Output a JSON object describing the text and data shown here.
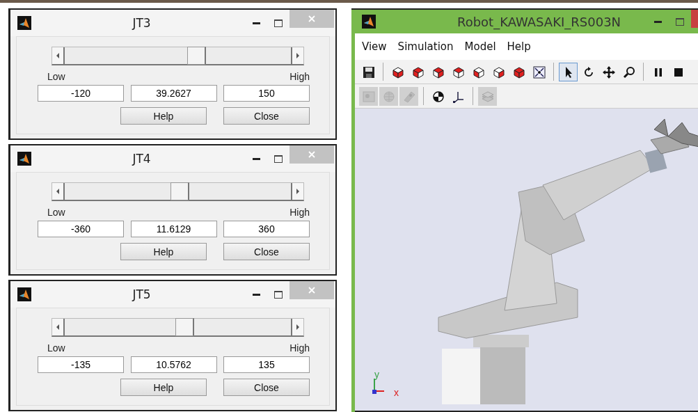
{
  "dialogs": [
    {
      "title": "JT3",
      "slider": {
        "level": 0.59
      },
      "low_label": "Low",
      "high_label": "High",
      "low": "-120",
      "value": "39.2627",
      "high": "150",
      "buttons": [
        "Help",
        "Close"
      ]
    },
    {
      "title": "JT4",
      "slider": {
        "level": 0.516
      },
      "low_label": "Low",
      "high_label": "High",
      "low": "-360",
      "value": "11.6129",
      "high": "360",
      "buttons": [
        "Help",
        "Close"
      ]
    },
    {
      "title": "JT5",
      "slider": {
        "level": 0.539
      },
      "low_label": "Low",
      "high_label": "High",
      "low": "-135",
      "value": "10.5762",
      "high": "135",
      "buttons": [
        "Help",
        "Close"
      ]
    }
  ],
  "main_window": {
    "title": "Robot_KAWASAKI_RS003N",
    "menu": [
      "View",
      "Simulation",
      "Model",
      "Help"
    ],
    "toolbars": [
      {
        "groups": [
          [
            {
              "kind": "save",
              "selected": false,
              "disabled": false
            }
          ],
          [
            {
              "kind": "cube",
              "selected": false,
              "disabled": false
            },
            {
              "kind": "cube",
              "selected": false,
              "disabled": false
            },
            {
              "kind": "cube",
              "selected": false,
              "disabled": false
            },
            {
              "kind": "cube",
              "selected": false,
              "disabled": false
            },
            {
              "kind": "cube",
              "selected": false,
              "disabled": false
            },
            {
              "kind": "cube",
              "selected": false,
              "disabled": false
            },
            {
              "kind": "cube",
              "selected": false,
              "disabled": false
            },
            {
              "kind": "fit",
              "selected": false,
              "disabled": false
            }
          ],
          [
            {
              "kind": "pointer",
              "selected": true,
              "disabled": false
            },
            {
              "kind": "rotate",
              "selected": false,
              "disabled": false
            },
            {
              "kind": "pan",
              "selected": false,
              "disabled": false
            },
            {
              "kind": "zoom",
              "selected": false,
              "disabled": false
            }
          ],
          [
            {
              "kind": "pause",
              "selected": false,
              "disabled": false
            },
            {
              "kind": "stop",
              "selected": false,
              "disabled": false
            }
          ]
        ]
      },
      {
        "groups": [
          [
            {
              "kind": "image",
              "selected": false,
              "disabled": true
            },
            {
              "kind": "grid",
              "selected": false,
              "disabled": true
            },
            {
              "kind": "tag",
              "selected": false,
              "disabled": true
            }
          ],
          [
            {
              "kind": "com",
              "selected": false,
              "disabled": false
            },
            {
              "kind": "axes",
              "selected": false,
              "disabled": false
            }
          ],
          [
            {
              "kind": "layers",
              "selected": false,
              "disabled": true
            }
          ]
        ]
      }
    ],
    "viewport": {
      "axis_y": "y",
      "axis_x": "x"
    }
  }
}
